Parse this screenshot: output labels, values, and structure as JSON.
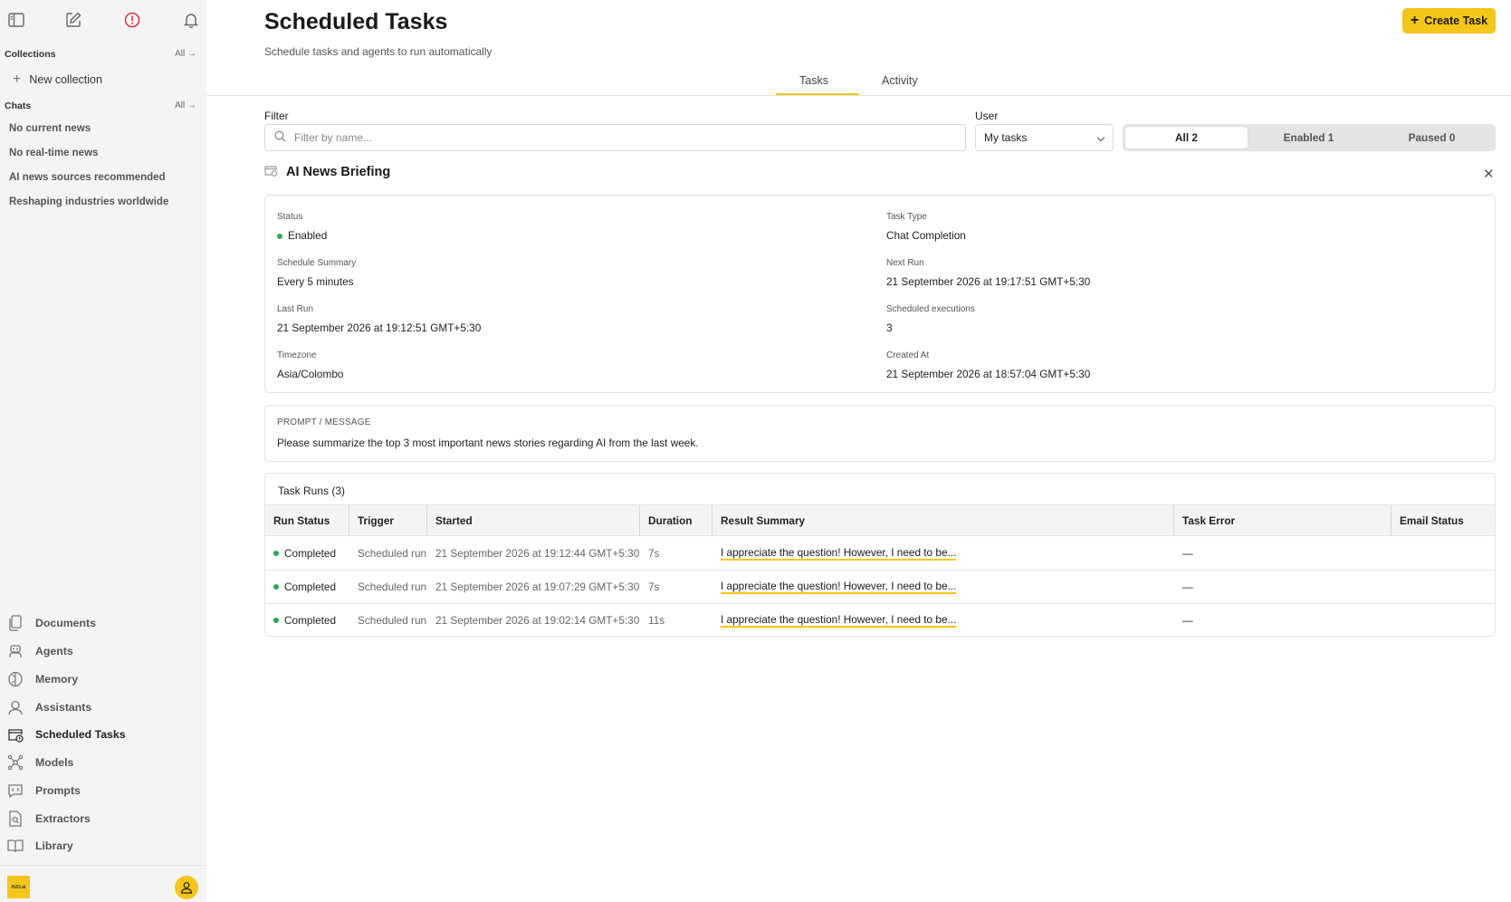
{
  "sidebar": {
    "collections_label": "Collections",
    "collections_all": "All",
    "new_collection": "New collection",
    "chats_label": "Chats",
    "chats_all": "All",
    "chats": [
      "No current news",
      "No real-time news",
      "AI news sources recommended",
      "Reshaping industries worldwide"
    ],
    "nav": [
      {
        "label": "Documents",
        "icon": "documents-icon"
      },
      {
        "label": "Agents",
        "icon": "agents-icon"
      },
      {
        "label": "Memory",
        "icon": "memory-icon"
      },
      {
        "label": "Assistants",
        "icon": "assistants-icon"
      },
      {
        "label": "Scheduled Tasks",
        "icon": "scheduled-tasks-icon"
      },
      {
        "label": "Models",
        "icon": "models-icon"
      },
      {
        "label": "Prompts",
        "icon": "prompts-icon"
      },
      {
        "label": "Extractors",
        "icon": "extractors-icon"
      },
      {
        "label": "Library",
        "icon": "library-icon"
      }
    ],
    "logo_text": "H2O.ai"
  },
  "header": {
    "title": "Scheduled Tasks",
    "subtitle": "Schedule tasks and agents to run automatically",
    "create_label": "Create Task"
  },
  "tabs": [
    "Tasks",
    "Activity"
  ],
  "filters": {
    "filter_label": "Filter",
    "filter_placeholder": "Filter by name...",
    "user_label": "User",
    "user_value": "My tasks",
    "segments": [
      "All 2",
      "Enabled 1",
      "Paused 0"
    ]
  },
  "task": {
    "name": "AI News Briefing",
    "details": {
      "status_label": "Status",
      "status": "Enabled",
      "task_type_label": "Task Type",
      "task_type": "Chat Completion",
      "schedule_label": "Schedule Summary",
      "schedule": "Every 5 minutes",
      "next_run_label": "Next Run",
      "next_run": "21 September 2026 at 19:17:51 GMT+5:30",
      "last_run_label": "Last Run",
      "last_run": "21 September 2026 at 19:12:51 GMT+5:30",
      "executions_label": "Scheduled executions",
      "executions": "3",
      "timezone_label": "Timezone",
      "timezone": "Asia/Colombo",
      "created_label": "Created At",
      "created": "21 September 2026 at 18:57:04 GMT+5:30"
    },
    "prompt_label": "PROMPT / MESSAGE",
    "prompt": "Please summarize the top 3 most important news stories regarding AI from the last week."
  },
  "runs": {
    "title": "Task Runs (3)",
    "columns": [
      "Run Status",
      "Trigger",
      "Started",
      "Duration",
      "Result Summary",
      "Task Error",
      "Email Status"
    ],
    "rows": [
      {
        "status": "Completed",
        "trigger": "Scheduled run",
        "started": "21 September 2026 at 19:12:44 GMT+5:30",
        "duration": "7s",
        "summary": "I appreciate the question! However, I need to be...",
        "error": "—",
        "email": ""
      },
      {
        "status": "Completed",
        "trigger": "Scheduled run",
        "started": "21 September 2026 at 19:07:29 GMT+5:30",
        "duration": "7s",
        "summary": "I appreciate the question! However, I need to be...",
        "error": "—",
        "email": ""
      },
      {
        "status": "Completed",
        "trigger": "Scheduled run",
        "started": "21 September 2026 at 19:02:14 GMT+5:30",
        "duration": "11s",
        "summary": "I appreciate the question! However, I need to be...",
        "error": "—",
        "email": ""
      }
    ]
  },
  "colors": {
    "accent": "#f5c518",
    "success": "#2fa84f",
    "alert": "#d9363e"
  }
}
